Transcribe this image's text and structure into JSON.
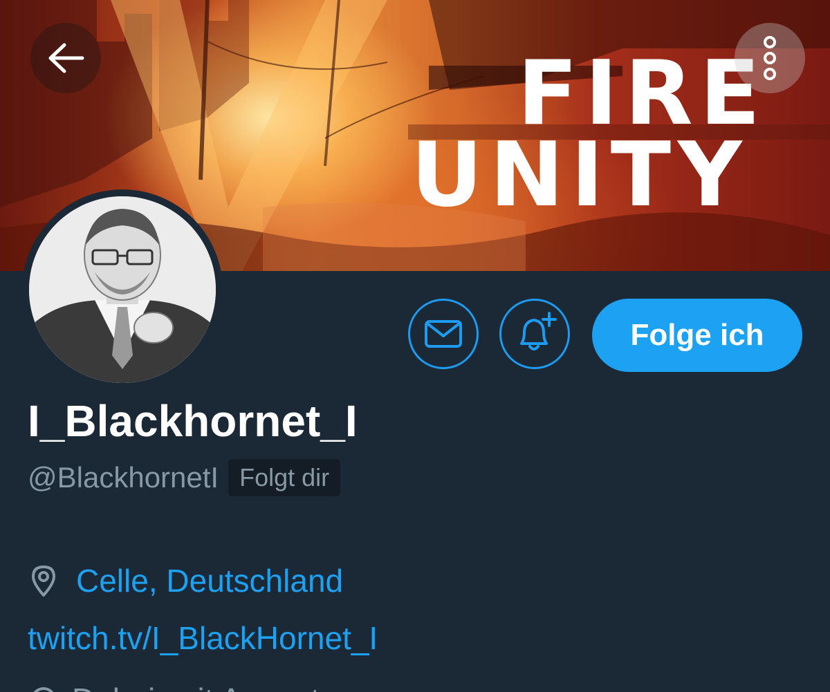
{
  "banner": {
    "line1": "FIRE",
    "line2": "UNITY"
  },
  "nav": {
    "back_icon": "arrow-left-icon",
    "more_icon": "more-vertical-icon"
  },
  "actions": {
    "message_icon": "mail-icon",
    "notify_icon": "bell-plus-icon",
    "follow_label": "Folge ich"
  },
  "profile": {
    "display_name": "I_Blackhornet_I",
    "handle": "@BlackhornetI",
    "follows_you": "Folgt dir",
    "location": "Celle, Deutschland",
    "website": "twitch.tv/I_BlackHornet_I",
    "joined": "Dabei seit August"
  },
  "colors": {
    "background": "#1b2836",
    "accent": "#1da1f2",
    "muted_text": "#8899a6"
  }
}
